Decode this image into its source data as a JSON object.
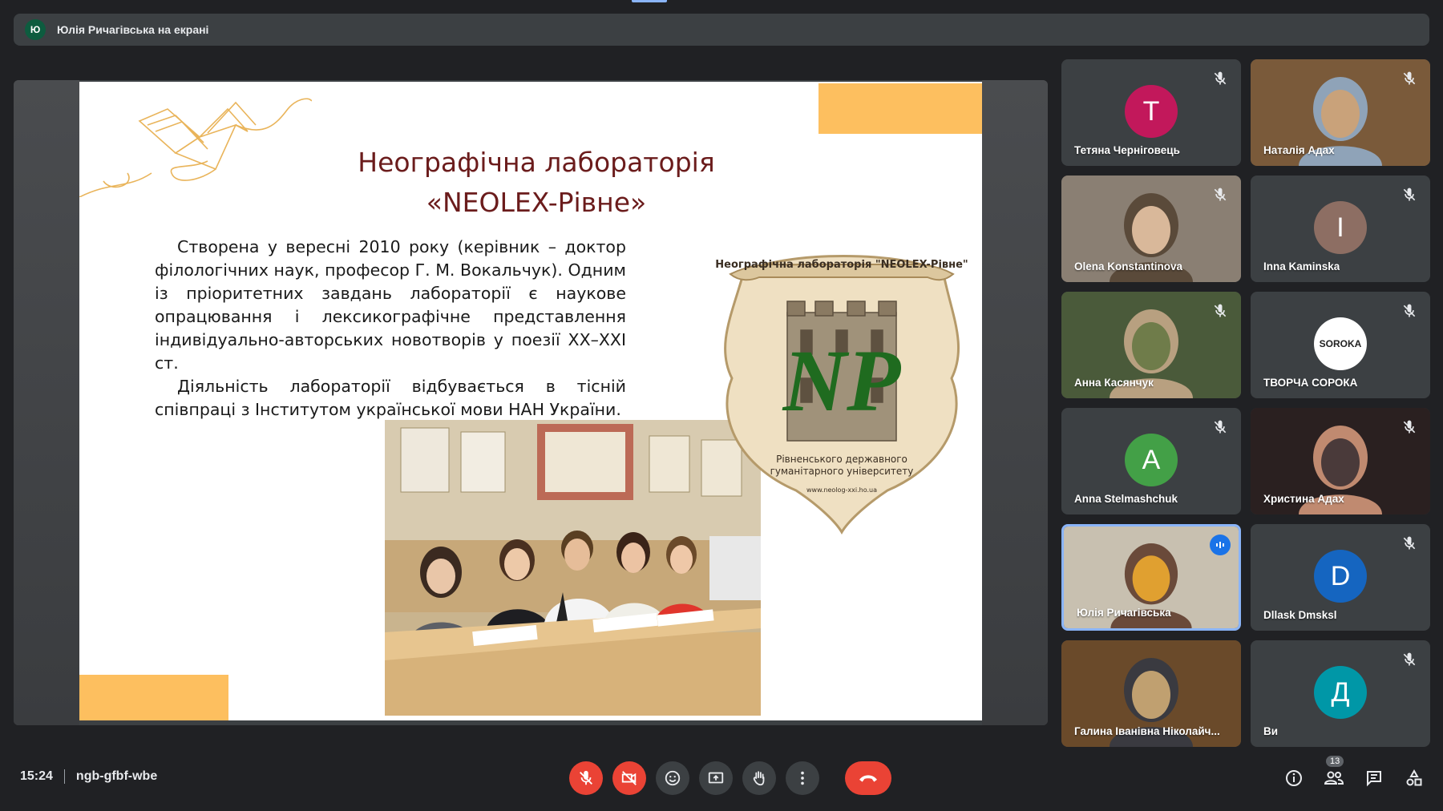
{
  "presenter_banner": {
    "avatar_letter": "Ю",
    "text": "Юлія Ричагівська на екрані"
  },
  "slide": {
    "title_line1": "Неографічна лабораторія",
    "title_line2": "«NEOLEX-Рівне»",
    "paragraph1": "Створена у вересні 2010 року (керівник – доктор філологічних наук, професор Г. М. Вокальчук). Одним із пріоритетних завдань лабораторії є наукове опрацювання і лексикографічне представлення індивідуально-авторських новотворів у поезії ХХ–ХХІ ст.",
    "paragraph2": "Діяльність лабораторії відбувається в тісній співпраці з Інститутом української мови НАН України.",
    "emblem_arc_text": "Неографічна лабораторія \"NEOLEX-Рівне\"",
    "emblem_monogram": "NP",
    "emblem_caption_line1": "Рівненського державного",
    "emblem_caption_line2": "гуманітарного університету",
    "emblem_url": "www.neolog-xxi.ho.ua"
  },
  "participants": [
    {
      "name": "Тетяна Черніговець",
      "type": "avatar",
      "letter": "T",
      "color": "#c2185b",
      "muted": true
    },
    {
      "name": "Наталія Адах",
      "type": "photo",
      "muted": true
    },
    {
      "name": "Olena Konstantinova",
      "type": "photo",
      "muted": true
    },
    {
      "name": "Inna Kaminska",
      "type": "avatar",
      "letter": "I",
      "color": "#8d6e63",
      "muted": true
    },
    {
      "name": "Анна Касянчук",
      "type": "photo",
      "muted": true
    },
    {
      "name": "ТВОРЧА СОРОКА",
      "type": "logo",
      "logo_text": "SOROKA",
      "muted": true
    },
    {
      "name": "Anna Stelmashchuk",
      "type": "avatar",
      "letter": "A",
      "color": "#43a047",
      "muted": true
    },
    {
      "name": "Христина Адах",
      "type": "photo",
      "muted": true
    },
    {
      "name": "Юлія Ричагівська",
      "type": "photo",
      "muted": false,
      "speaking": true
    },
    {
      "name": "Dllask Dmsksl",
      "type": "avatar",
      "letter": "D",
      "color": "#1565c0",
      "muted": true
    },
    {
      "name": "Галина Іванівна Ніколайч...",
      "type": "photo",
      "muted": false
    },
    {
      "name": "Ви",
      "type": "avatar",
      "letter": "Д",
      "color": "#0097a7",
      "muted": true
    }
  ],
  "meeting": {
    "time": "15:24",
    "code": "ngb-gfbf-wbe"
  },
  "controls": [
    "mic-off",
    "camera-off",
    "reactions",
    "present",
    "raise-hand",
    "more-options",
    "leave-call"
  ],
  "right_panel": {
    "participants_count": "13"
  },
  "colors": {
    "background": "#202124",
    "tile": "#3c4043",
    "danger": "#ea4335",
    "slide_accent": "#fdbf5f",
    "title": "#6b1c1c",
    "active_border": "#8ab4f8"
  }
}
